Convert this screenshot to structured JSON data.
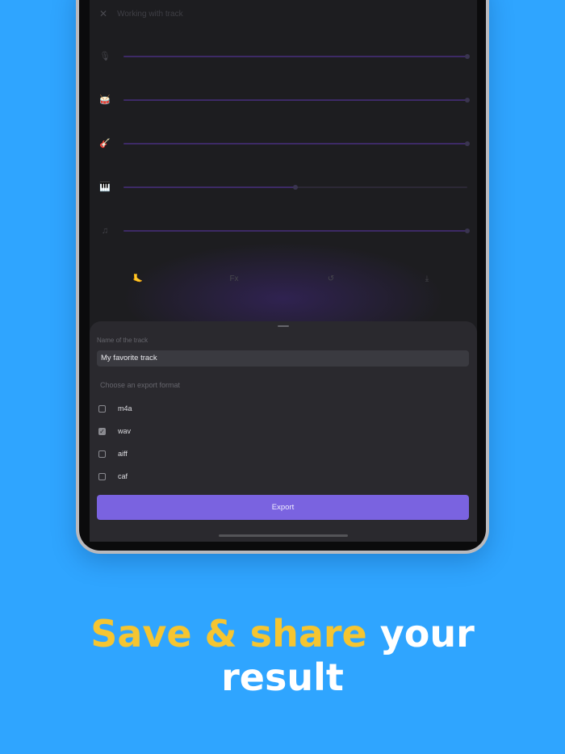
{
  "screen": {
    "title": "Working with track",
    "tracks": [
      {
        "icon": "microphone-icon",
        "glyph": "🎙",
        "level": 1.0
      },
      {
        "icon": "drum-icon",
        "glyph": "🥁",
        "level": 1.0
      },
      {
        "icon": "guitar-icon",
        "glyph": "🎸",
        "level": 1.0
      },
      {
        "icon": "piano-icon",
        "glyph": "🎹",
        "level": 0.5
      },
      {
        "icon": "music-note-icon",
        "glyph": "♫",
        "level": 1.0
      }
    ],
    "toolbar": {
      "tempo": "🦶",
      "fx": "Fx",
      "undo": "↺",
      "download": "⤓"
    }
  },
  "sheet": {
    "name_label": "Name of the track",
    "name_value": "My favorite track",
    "format_label": "Choose an export format",
    "formats": [
      {
        "label": "m4a",
        "checked": false
      },
      {
        "label": "wav",
        "checked": true
      },
      {
        "label": "aiff",
        "checked": false
      },
      {
        "label": "caf",
        "checked": false
      }
    ],
    "export_label": "Export"
  },
  "headline": {
    "accent": "Save & share",
    "rest_line1": "your",
    "line2": "result"
  },
  "colors": {
    "background": "#2fa5ff",
    "accent_text": "#f5c531",
    "export_button": "#7a63e0"
  }
}
